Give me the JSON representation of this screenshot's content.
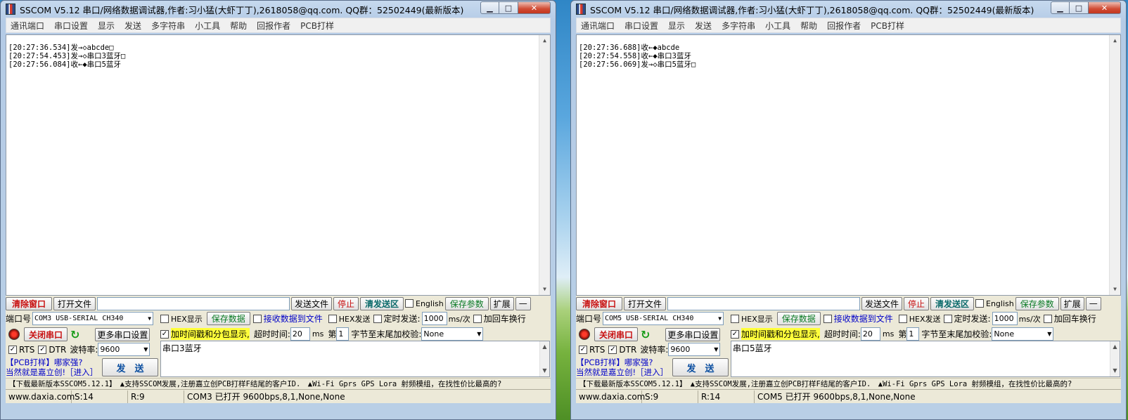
{
  "windows": [
    {
      "title": "SSCOM V5.12 串口/网络数据调试器,作者:习小猛(大虾丁丁),2618058@qq.com. QQ群：52502449(最新版本)",
      "menu": [
        "通讯端口",
        "串口设置",
        "显示",
        "发送",
        "多字符串",
        "小工具",
        "帮助",
        "回报作者",
        "PCB打样"
      ],
      "recv_lines": [
        "[20:27:36.534]发→◇abcde□",
        "[20:27:54.453]发→◇串口3蓝牙□",
        "[20:27:56.084]收←◆串口5蓝牙"
      ],
      "toolbar": {
        "clear": "清除窗口",
        "open_file": "打开文件",
        "file_path": "",
        "send_file": "发送文件",
        "stop": "停止",
        "clear_send": "清发送区",
        "english": "English",
        "save_params": "保存参数",
        "expand": "扩展",
        "collapse": "—"
      },
      "port_label": "端口号",
      "port_value": "COM3 USB-SERIAL CH340",
      "hex_display": "HEX显示",
      "save_data": "保存数据",
      "recv_to_file": "接收数据到文件",
      "hex_send": "HEX发送",
      "timed_send": "定时发送:",
      "interval": "1000",
      "interval_unit": "ms/次",
      "add_crlf": "加回车换行",
      "close_port": "关闭串口",
      "more_settings": "更多串口设置",
      "timestamp": "加时间戳和分包显示,",
      "timeout_label": "超时时间:",
      "timeout_value": "20",
      "timeout_unit": "ms",
      "nth_label": "第",
      "nth_value": "1",
      "checksum_label": "字节至末尾加校验:",
      "checksum_value": "None",
      "rts": "RTS",
      "dtr": "DTR",
      "baud_label": "波特率:",
      "baud_value": "9600",
      "send_text": "串口3蓝牙",
      "pcb_line1": "【PCB打样】哪家强?",
      "pcb_line2": "当然就是嘉立创!［进入］",
      "send_button": "发　送",
      "ad_text": "【下载最新版本SSCOM5.12.1】　▲支持SSCOM发展,注册嘉立创PCB打样F结尾的客户ID.　▲Wi-Fi Gprs GPS Lora 射频模组，在找性价比最高的?",
      "status": {
        "site": "www.daxia.com",
        "sent": "S:14",
        "received": "R:9",
        "port_info": "COM3 已打开  9600bps,8,1,None,None"
      }
    },
    {
      "title": "SSCOM V5.12 串口/网络数据调试器,作者:习小猛(大虾丁丁),2618058@qq.com. QQ群：52502449(最新版本)",
      "menu": [
        "通讯端口",
        "串口设置",
        "显示",
        "发送",
        "多字符串",
        "小工具",
        "帮助",
        "回报作者",
        "PCB打样"
      ],
      "recv_lines": [
        "[20:27:36.688]收←◆abcde",
        "[20:27:54.558]收←◆串口3蓝牙",
        "[20:27:56.069]发→◇串口5蓝牙□"
      ],
      "toolbar": {
        "clear": "清除窗口",
        "open_file": "打开文件",
        "file_path": "",
        "send_file": "发送文件",
        "stop": "停止",
        "clear_send": "清发送区",
        "english": "English",
        "save_params": "保存参数",
        "expand": "扩展",
        "collapse": "—"
      },
      "port_label": "端口号",
      "port_value": "COM5 USB-SERIAL CH340",
      "hex_display": "HEX显示",
      "save_data": "保存数据",
      "recv_to_file": "接收数据到文件",
      "hex_send": "HEX发送",
      "timed_send": "定时发送:",
      "interval": "1000",
      "interval_unit": "ms/次",
      "add_crlf": "加回车换行",
      "close_port": "关闭串口",
      "more_settings": "更多串口设置",
      "timestamp": "加时间戳和分包显示,",
      "timeout_label": "超时时间:",
      "timeout_value": "20",
      "timeout_unit": "ms",
      "nth_label": "第",
      "nth_value": "1",
      "checksum_label": "字节至末尾加校验:",
      "checksum_value": "None",
      "rts": "RTS",
      "dtr": "DTR",
      "baud_label": "波特率:",
      "baud_value": "9600",
      "send_text": "串口5蓝牙",
      "pcb_line1": "【PCB打样】哪家强?",
      "pcb_line2": "当然就是嘉立创!［进入］",
      "send_button": "发　送",
      "ad_text": "【下载最新版本SSCOM5.12.1】　▲支持SSCOM发展,注册嘉立创PCB打样F结尾的客户ID.　▲Wi-Fi Gprs GPS Lora 射频模组，在找性价比最高的?",
      "status": {
        "site": "www.daxia.com",
        "sent": "S:9",
        "received": "R:14",
        "port_info": "COM5 已打开  9600bps,8,1,None,None"
      }
    }
  ],
  "caption_buttons": {
    "minimize": "▁",
    "maximize": "□",
    "close": "✕"
  },
  "checkbox_mark": "✓",
  "dropdown_arrow": "▼",
  "refresh_glyph": "↻"
}
